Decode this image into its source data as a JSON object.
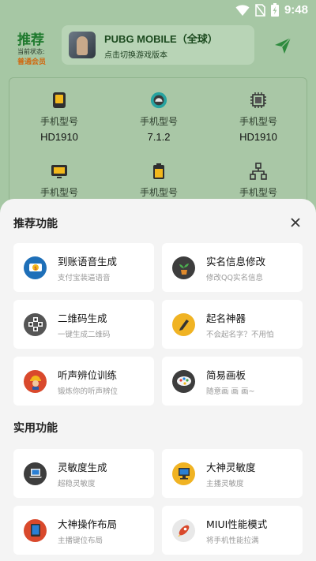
{
  "status_bar": {
    "time": "9:48"
  },
  "header": {
    "brand": "推荐",
    "status_label": "当前状态:",
    "status_value": "普通会员",
    "game": {
      "title": "PUBG MOBILE（全球）",
      "subtitle": "点击切换游戏版本"
    }
  },
  "device_info": [
    {
      "label": "手机型号",
      "value": "HD1910",
      "icon": "chip-yellow-icon"
    },
    {
      "label": "手机型号",
      "value": "7.1.2",
      "icon": "android-icon"
    },
    {
      "label": "手机型号",
      "value": "HD1910",
      "icon": "cpu-icon"
    },
    {
      "label": "手机型号",
      "value": "",
      "icon": "monitor-icon"
    },
    {
      "label": "手机型号",
      "value": "",
      "icon": "battery-icon"
    },
    {
      "label": "手机型号",
      "value": "",
      "icon": "network-icon"
    }
  ],
  "sheet": {
    "section_recommended": "推荐功能",
    "section_practical": "实用功能",
    "recommended": [
      {
        "title": "到账语音生成",
        "subtitle": "支付宝装逼语音",
        "icon": "coin-icon"
      },
      {
        "title": "实名信息修改",
        "subtitle": "修改QQ实名信息",
        "icon": "plant-icon"
      },
      {
        "title": "二维码生成",
        "subtitle": "一键生成二维码",
        "icon": "qrcode-icon"
      },
      {
        "title": "起名神器",
        "subtitle": "不会起名字？不用怕",
        "icon": "pen-icon"
      },
      {
        "title": "听声辨位训练",
        "subtitle": "锻炼你的听声辨位",
        "icon": "soldier-icon"
      },
      {
        "title": "简易画板",
        "subtitle": "随意画 画 画~",
        "icon": "palette-icon"
      }
    ],
    "practical": [
      {
        "title": "灵敏度生成",
        "subtitle": "超稳灵敏度",
        "icon": "laptop-icon"
      },
      {
        "title": "大神灵敏度",
        "subtitle": "主播灵敏度",
        "icon": "desktop-icon"
      },
      {
        "title": "大神操作布局",
        "subtitle": "主播键位布局",
        "icon": "tablet-icon"
      },
      {
        "title": "MIUI性能模式",
        "subtitle": "将手机性能拉满",
        "icon": "rocket-icon"
      }
    ]
  },
  "colors": {
    "brand_green": "#1f7a2e",
    "member_orange": "#d06a12",
    "sheet_bg": "#f4f4f4"
  }
}
